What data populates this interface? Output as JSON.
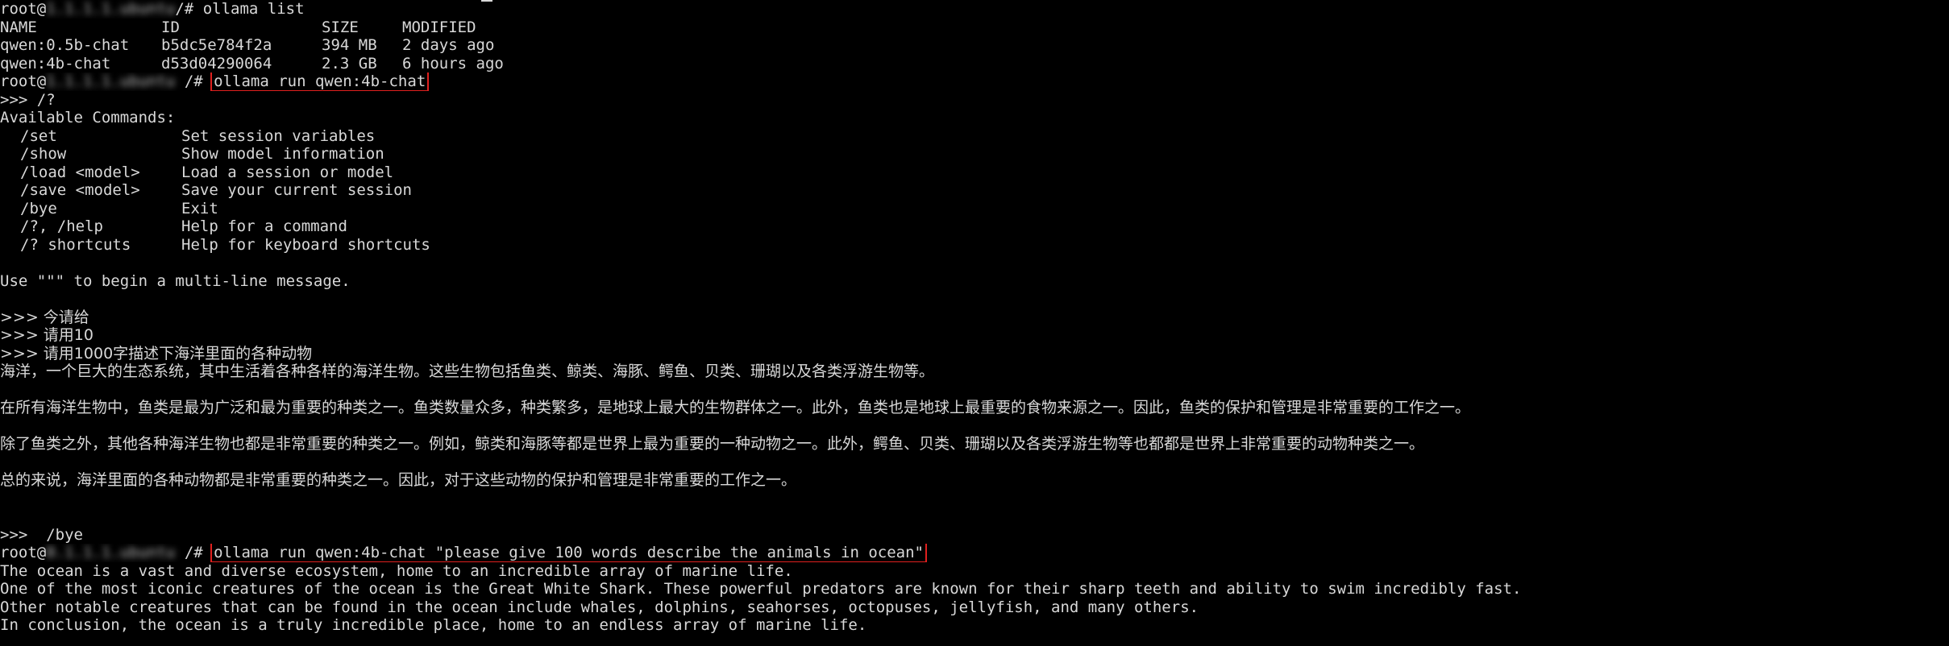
{
  "theme": {
    "background": "#000000",
    "foreground": "#d8d8d8",
    "highlight_border": "#e0201e"
  },
  "prompt": {
    "user": "root@",
    "suffix": "/#",
    "host_redacted_1": "1.1.1.1.ubuntu",
    "host_redacted_2": "1.1.1.1.ubuntu",
    "host_redacted_3": "0.1.1.1.ubuntu"
  },
  "cmd_list": "ollama list",
  "list_header": {
    "name": "NAME",
    "id": "ID",
    "size": "SIZE",
    "modified": "MODIFIED"
  },
  "models": [
    {
      "name": "qwen:0.5b-chat",
      "id": "b5dc5e784f2a",
      "size": "394 MB",
      "modified": "2 days ago"
    },
    {
      "name": "qwen:4b-chat",
      "id": "d53d04290064",
      "size": "2.3 GB",
      "modified": "6 hours ago"
    }
  ],
  "cmd_run": "ollama run qwen:4b-chat",
  "help_prompt": ">>> /?",
  "available_commands": "Available Commands:",
  "commands": [
    {
      "cmd": "/set",
      "desc": "Set session variables"
    },
    {
      "cmd": "/show",
      "desc": "Show model information"
    },
    {
      "cmd": "/load <model>",
      "desc": "Load a session or model"
    },
    {
      "cmd": "/save <model>",
      "desc": "Save your current session"
    },
    {
      "cmd": "/bye",
      "desc": "Exit"
    },
    {
      "cmd": "/?, /help",
      "desc": "Help for a command"
    },
    {
      "cmd": "/? shortcuts",
      "desc": "Help for keyboard shortcuts"
    }
  ],
  "multiline_hint": "Use \"\"\" to begin a multi-line message.",
  "chat_inputs": [
    ">>> 今请给",
    ">>> 请用10",
    ">>> 请用1000字描述下海洋里面的各种动物"
  ],
  "chat_response": [
    "海洋，一个巨大的生态系统，其中生活着各种各样的海洋生物。这些生物包括鱼类、鲸类、海豚、鳄鱼、贝类、珊瑚以及各类浮游生物等。",
    "在所有海洋生物中，鱼类是最为广泛和最为重要的种类之一。鱼类数量众多，种类繁多，是地球上最大的生物群体之一。此外，鱼类也是地球上最重要的食物来源之一。因此，鱼类的保护和管理是非常重要的工作之一。",
    "除了鱼类之外，其他各种海洋生物也都是非常重要的种类之一。例如，鲸类和海豚等都是世界上最为重要的一种动物之一。此外，鳄鱼、贝类、珊瑚以及各类浮游生物等也都都是世界上非常重要的动物种类之一。",
    "总的来说，海洋里面的各种动物都是非常重要的种类之一。因此，对于这些动物的保护和管理是非常重要的工作之一。"
  ],
  "bye_line": ">>>  /bye",
  "cmd_run_prompt": "ollama run qwen:4b-chat \"please give 100 words describe the animals in ocean\"",
  "english_response": [
    "The ocean is a vast and diverse ecosystem, home to an incredible array of marine life.",
    "One of the most iconic creatures of the ocean is the Great White Shark. These powerful predators are known for their sharp teeth and ability to swim incredibly fast.",
    "Other notable creatures that can be found in the ocean include whales, dolphins, seahorses, octopuses, jellyfish, and many others.",
    "In conclusion, the ocean is a truly incredible place, home to an endless array of marine life."
  ]
}
